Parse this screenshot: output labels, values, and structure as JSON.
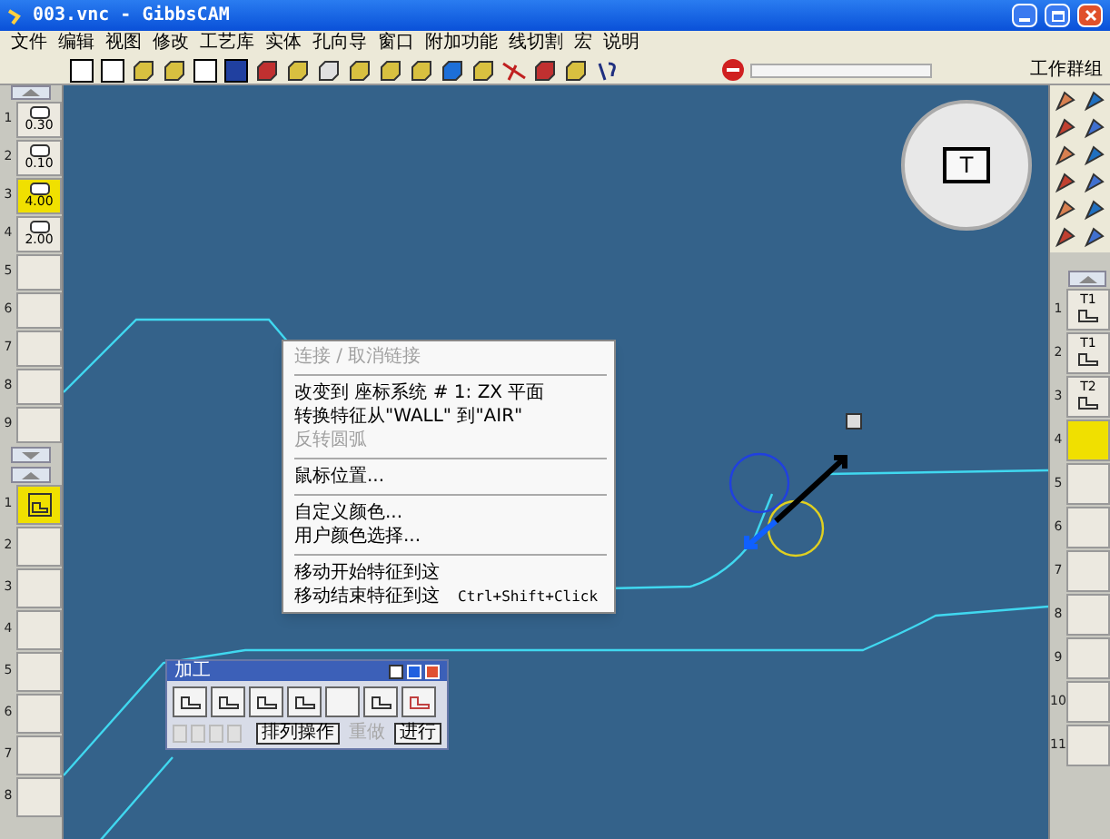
{
  "window": {
    "title": "003.vnc - GibbsCAM"
  },
  "menu": [
    "文件",
    "编辑",
    "视图",
    "修改",
    "工艺库",
    "实体",
    "孔向导",
    "窗口",
    "附加功能",
    "线切割",
    "宏",
    "说明"
  ],
  "workgroup_label": "工作群组",
  "tool_list": [
    {
      "number": "1",
      "value": "0.30",
      "selected": false
    },
    {
      "number": "2",
      "value": "0.10",
      "selected": false
    },
    {
      "number": "3",
      "value": "4.00",
      "selected": true
    },
    {
      "number": "4",
      "value": "2.00",
      "selected": false
    },
    {
      "number": "5"
    },
    {
      "number": "6"
    },
    {
      "number": "7"
    },
    {
      "number": "8"
    },
    {
      "number": "9"
    }
  ],
  "process_list": [
    {
      "number": "1",
      "selected": true
    },
    {
      "number": "2",
      "selected": false
    },
    {
      "number": "3",
      "selected": false
    },
    {
      "number": "4",
      "selected": false
    },
    {
      "number": "5",
      "selected": false
    },
    {
      "number": "6",
      "selected": false
    },
    {
      "number": "7",
      "selected": false
    },
    {
      "number": "8",
      "selected": false
    }
  ],
  "operation_list": [
    {
      "number": "1",
      "tool": "T1",
      "selected": false
    },
    {
      "number": "2",
      "tool": "T1",
      "selected": false
    },
    {
      "number": "3",
      "tool": "T2",
      "selected": false
    },
    {
      "number": "4",
      "selected": true
    },
    {
      "number": "5",
      "selected": false
    },
    {
      "number": "6",
      "selected": false
    },
    {
      "number": "7",
      "selected": false
    },
    {
      "number": "8",
      "selected": false
    },
    {
      "number": "9",
      "selected": false
    },
    {
      "number": "10",
      "selected": false
    },
    {
      "number": "11",
      "selected": false
    }
  ],
  "radial_menu": {
    "center_label": "T"
  },
  "context_menu": [
    {
      "kind": "item",
      "label": "连接 / 取消链接",
      "disabled": true
    },
    {
      "kind": "separator"
    },
    {
      "kind": "item",
      "label": "改变到 座标系统 # 1: ZX 平面",
      "disabled": false
    },
    {
      "kind": "item",
      "label": "转换特征从\"WALL\" 到\"AIR\"",
      "disabled": false
    },
    {
      "kind": "item",
      "label": "反转圆弧",
      "disabled": true
    },
    {
      "kind": "separator"
    },
    {
      "kind": "item",
      "label": "鼠标位置...",
      "disabled": false
    },
    {
      "kind": "separator"
    },
    {
      "kind": "item",
      "label": "自定义颜色...",
      "disabled": false
    },
    {
      "kind": "item",
      "label": "用户颜色选择...",
      "disabled": false
    },
    {
      "kind": "separator"
    },
    {
      "kind": "item",
      "label": "移动开始特征到这",
      "disabled": false
    },
    {
      "kind": "item",
      "label": "移动结束特征到这",
      "shortcut": "Ctrl+Shift+Click",
      "disabled": false
    }
  ],
  "machining_palette": {
    "title": "加工",
    "buttons": [
      {
        "label": "排列操作",
        "disabled": false
      },
      {
        "label": "重做",
        "disabled": true
      },
      {
        "label": "进行",
        "disabled": false
      }
    ]
  }
}
